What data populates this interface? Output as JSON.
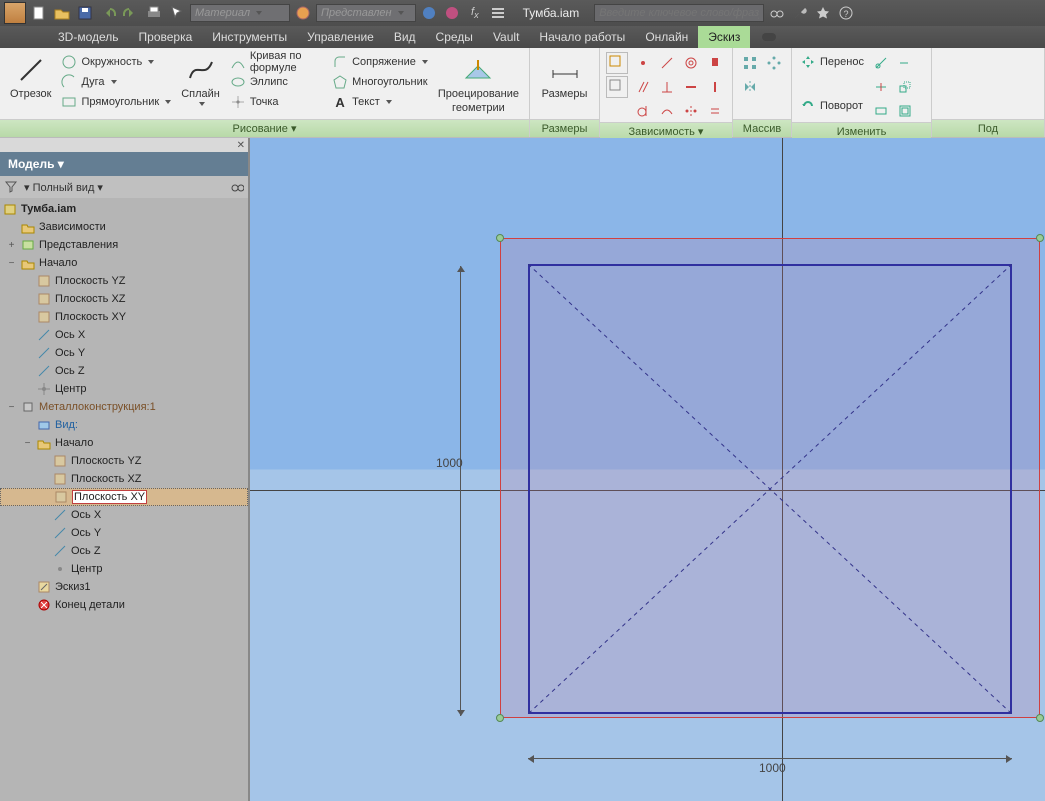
{
  "title_doc": "Тумба.iam",
  "search_placeholder": "Введите ключевое слово/фразу",
  "combo_material": "Материал",
  "combo_view": "Представлен",
  "menubar": {
    "items": [
      "3D-модель",
      "Проверка",
      "Инструменты",
      "Управление",
      "Вид",
      "Среды",
      "Vault",
      "Начало работы",
      "Онлайн",
      "Эскиз"
    ],
    "active_index": 9
  },
  "ribbon": {
    "panel_draw_label": "Рисование ▾",
    "otrezok": "Отрезок",
    "okruzhnost": "Окружность",
    "duga": "Дуга",
    "pryamoug": "Прямоугольник",
    "spline": "Сплайн",
    "ellipse": "Эллипс",
    "tochka": "Точка",
    "krivaya": "Кривая по формуле",
    "mnogoug": "Многоугольник",
    "tekst": "Текст",
    "sopryazh": "Сопряжение",
    "proec_geom1": "Проецирование",
    "proec_geom2": "геометрии",
    "panel_size_label": "Размеры",
    "panel_zavis_label": "Зависимость ▾",
    "panel_massiv_label": "Массив",
    "perenos": "Перенос",
    "povorot": "Поворот",
    "panel_izmenit_label": "Изменить",
    "panel_pod_label": "Под"
  },
  "browser": {
    "header": "Модель ▾",
    "full_view": "Полный вид",
    "root": "Тумба.iam",
    "items": {
      "zavisimosti": "Зависимости",
      "predstavleniya": "Представления",
      "nachalo": "Начало",
      "plane_yz": "Плоскость YZ",
      "plane_xz": "Плоскость XZ",
      "plane_xy": "Плоскость XY",
      "axis_x": "Ось X",
      "axis_y": "Ось Y",
      "axis_z": "Ось Z",
      "center": "Центр",
      "metallo": "Металлоконструкция:1",
      "vid": "Вид:",
      "nachalo2": "Начало",
      "eskiz": "Эскиз1",
      "konets": "Конец детали"
    }
  },
  "dims": {
    "height": "1000",
    "width": "1000"
  }
}
